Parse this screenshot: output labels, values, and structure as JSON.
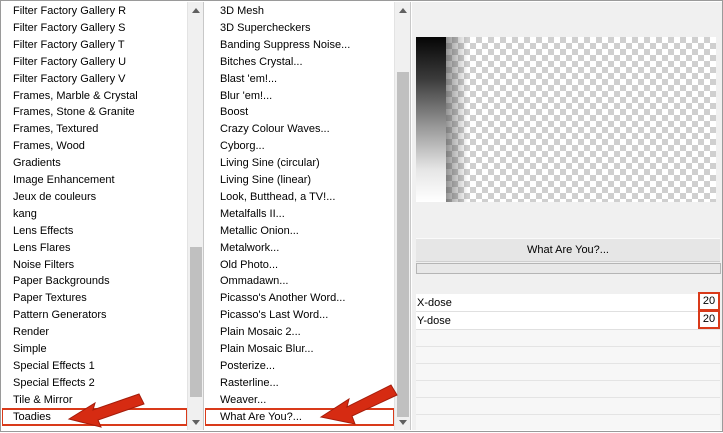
{
  "categories": {
    "items": [
      "Filter Factory Gallery R",
      "Filter Factory Gallery S",
      "Filter Factory Gallery T",
      "Filter Factory Gallery U",
      "Filter Factory Gallery V",
      "Frames, Marble & Crystal",
      "Frames, Stone & Granite",
      "Frames, Textured",
      "Frames, Wood",
      "Gradients",
      "Image Enhancement",
      "Jeux de couleurs",
      "kang",
      "Lens Effects",
      "Lens Flares",
      "Noise Filters",
      "Paper Backgrounds",
      "Paper Textures",
      "Pattern Generators",
      "Render",
      "Simple",
      "Special Effects 1",
      "Special Effects 2",
      "Tile & Mirror",
      "Toadies"
    ],
    "selected_index": 24
  },
  "filters": {
    "items": [
      "3D Mesh",
      "3D Supercheckers",
      "Banding Suppress Noise...",
      "Bitches Crystal...",
      "Blast 'em!...",
      "Blur 'em!...",
      "Boost",
      "Crazy Colour Waves...",
      "Cyborg...",
      "Living Sine (circular)",
      "Living Sine (linear)",
      "Look, Butthead, a TV!...",
      "Metalfalls II...",
      "Metallic Onion...",
      "Metalwork...",
      "Old Photo...",
      "Ommadawn...",
      "Picasso's Another Word...",
      "Picasso's Last Word...",
      "Plain Mosaic 2...",
      "Plain Mosaic Blur...",
      "Posterize...",
      "Rasterline...",
      "Weaver...",
      "What Are You?..."
    ],
    "selected_index": 24
  },
  "settings": {
    "filter_title": "What Are You?...",
    "params": [
      {
        "label": "X-dose",
        "value": "20"
      },
      {
        "label": "Y-dose",
        "value": "20"
      }
    ]
  },
  "colors": {
    "highlight": "#d93a1a",
    "annotation_arrow": "#d62b12"
  },
  "icons": [
    "scroll-up-icon",
    "scroll-down-icon",
    "pointer-arrow-icon"
  ]
}
